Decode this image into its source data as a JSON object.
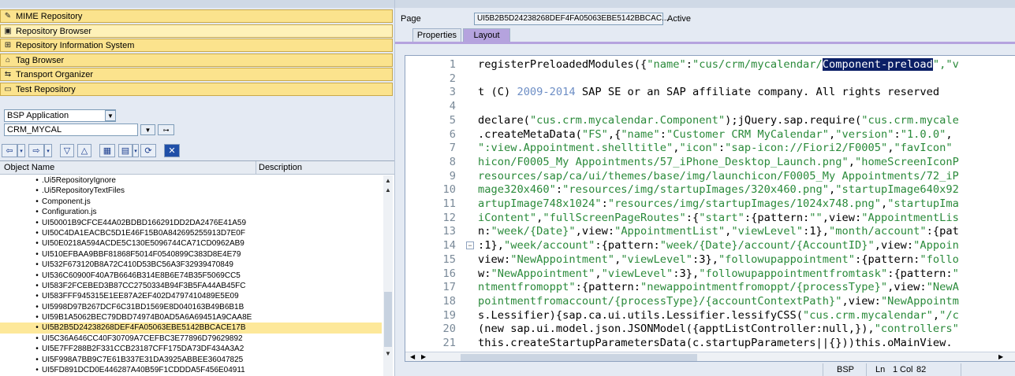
{
  "left_nav": {
    "items": [
      {
        "label": "MIME Repository",
        "icon": "mime-icon"
      },
      {
        "label": "Repository Browser",
        "icon": "browser-icon"
      },
      {
        "label": "Repository Information System",
        "icon": "info-system-icon"
      },
      {
        "label": "Tag Browser",
        "icon": "tag-icon"
      },
      {
        "label": "Transport Organizer",
        "icon": "transport-icon"
      },
      {
        "label": "Test Repository",
        "icon": "test-icon"
      }
    ]
  },
  "object_selector": {
    "type_value": "BSP Application",
    "name_value": "CRM_MYCAL"
  },
  "tree": {
    "col_object_name": "Object Name",
    "col_description": "Description",
    "rows": [
      ".Ui5RepositoryIgnore",
      ".Ui5RepositoryTextFiles",
      "Component.js",
      "Configuration.js",
      "UI50001B9CFCE44A02BDBD166291DD2DA2476E41A59",
      "UI50C4DA1EACBC5D1E46F15B0A842695255913D7E0F",
      "UI50E0218A594ACDE5C130E5096744CA71CD0962AB9",
      "UI510EFBAA9BBF81868F5014F0540899C383D8E4E79",
      "UI532F673120B8A72C410D53BC56A3F32939470849",
      "UI536C60900F40A7B6646B314E8B6E74B35F5069CC5",
      "UI583F2FCEBED3B87CC2750334B94F3B5FA44AB45FC",
      "UI583FFF945315E1EE87A2EF402D4797410489E5E09",
      "UI5998D97B267DCF6C31BD1569E8D040163B49B6B1B",
      "UI59B1A5062BEC79DBD74974B0AD5A6A69451A9CAA8E",
      "UI5B2B5D24238268DEF4FA05063EBE5142BBCACE17B",
      "UI5C36A646CC40F30709A7CEFBC3E77896D79629892",
      "UI5E7FF288B2F331CCB23187CFF175DA73DF434A3A2",
      "UI5F998A7BB9C7E61B337E31DA3925ABBEE36047825",
      "UI5FD891DCD0E446287A40B59F1CDDDA5F456E04911"
    ]
  },
  "right": {
    "page_label": "Page",
    "page_value": "UI5B2B5D24238268DEF4FA05063EBE5142BBCAC...",
    "page_status": "Active",
    "tab_properties": "Properties",
    "tab_layout": "Layout"
  },
  "code": {
    "lines": [
      {
        "n": "1",
        "segs": [
          [
            "registerPreloadedModules({",
            ""
          ],
          [
            "\"name\"",
            "g"
          ],
          [
            ":",
            ""
          ],
          [
            "\"cus/crm/mycalendar/",
            "g"
          ],
          [
            "Component-preload",
            "hl"
          ],
          [
            "\",\"v",
            "g"
          ]
        ]
      },
      {
        "n": "2",
        "segs": []
      },
      {
        "n": "3",
        "segs": [
          [
            "t (C) ",
            ""
          ],
          [
            "2009-2014",
            "b"
          ],
          [
            " SAP SE or an SAP affiliate company. All rights reserved",
            ""
          ]
        ]
      },
      {
        "n": "4",
        "segs": []
      },
      {
        "n": "5",
        "segs": [
          [
            "declare(",
            ""
          ],
          [
            "\"cus.crm.mycalendar.Component\"",
            "g"
          ],
          [
            ");jQuery.sap.require(",
            ""
          ],
          [
            "\"cus.crm.mycale",
            "g"
          ]
        ]
      },
      {
        "n": "6",
        "segs": [
          [
            ".createMetaData(",
            ""
          ],
          [
            "\"FS\"",
            "g"
          ],
          [
            ",{",
            ""
          ],
          [
            "\"name\"",
            "g"
          ],
          [
            ":",
            ""
          ],
          [
            "\"Customer CRM MyCalendar\"",
            "g"
          ],
          [
            ",",
            ""
          ],
          [
            "\"version\"",
            "g"
          ],
          [
            ":",
            ""
          ],
          [
            "\"1.0.0\"",
            "g"
          ],
          [
            ",",
            ""
          ]
        ]
      },
      {
        "n": "7",
        "segs": [
          [
            "\":view.Appointment.shelltitle\"",
            "g"
          ],
          [
            ",",
            ""
          ],
          [
            "\"icon\"",
            "g"
          ],
          [
            ":",
            ""
          ],
          [
            "\"sap-icon://Fiori2/F0005\"",
            "g"
          ],
          [
            ",",
            ""
          ],
          [
            "\"favIcon\"",
            "g"
          ]
        ]
      },
      {
        "n": "8",
        "segs": [
          [
            "hicon/F0005_My Appointments/57_iPhone_Desktop_Launch.png\"",
            "g"
          ],
          [
            ",",
            ""
          ],
          [
            "\"homeScreenIconP",
            "g"
          ]
        ]
      },
      {
        "n": "9",
        "segs": [
          [
            "resources/sap/ca/ui/themes/base/img/launchicon/F0005_My Appointments/72_iP",
            "g"
          ]
        ]
      },
      {
        "n": "10",
        "segs": [
          [
            "mage320x460\"",
            "g"
          ],
          [
            ":",
            ""
          ],
          [
            "\"resources/img/startupImages/320x460.png\"",
            "g"
          ],
          [
            ",",
            ""
          ],
          [
            "\"startupImage640x92",
            "g"
          ]
        ]
      },
      {
        "n": "11",
        "segs": [
          [
            "artupImage748x1024\"",
            "g"
          ],
          [
            ":",
            ""
          ],
          [
            "\"resources/img/startupImages/1024x748.png\"",
            "g"
          ],
          [
            ",",
            ""
          ],
          [
            "\"startupIma",
            "g"
          ]
        ]
      },
      {
        "n": "12",
        "segs": [
          [
            "iContent\"",
            "g"
          ],
          [
            ",",
            ""
          ],
          [
            "\"fullScreenPageRoutes\"",
            "g"
          ],
          [
            ":{",
            ""
          ],
          [
            "\"start\"",
            "g"
          ],
          [
            ":{pattern:",
            ""
          ],
          [
            "\"\"",
            "g"
          ],
          [
            ",view:",
            ""
          ],
          [
            "\"AppointmentLis",
            "g"
          ]
        ]
      },
      {
        "n": "13",
        "segs": [
          [
            "n:",
            ""
          ],
          [
            "\"week/{Date}\"",
            "g"
          ],
          [
            ",view:",
            ""
          ],
          [
            "\"AppointmentList\"",
            "g"
          ],
          [
            ",",
            ""
          ],
          [
            "\"viewLevel\"",
            "g"
          ],
          [
            ":1},",
            ""
          ],
          [
            "\"month/account\"",
            "g"
          ],
          [
            ":{pat",
            ""
          ]
        ]
      },
      {
        "n": "14",
        "segs": [
          [
            ":1},",
            ""
          ],
          [
            "\"week/account\"",
            "g"
          ],
          [
            ":{pattern:",
            ""
          ],
          [
            "\"week/{Date}/account/{AccountID}\"",
            "g"
          ],
          [
            ",view:",
            ""
          ],
          [
            "\"Appoin",
            "g"
          ]
        ]
      },
      {
        "n": "15",
        "segs": [
          [
            "view:",
            ""
          ],
          [
            "\"NewAppointment\"",
            "g"
          ],
          [
            ",",
            ""
          ],
          [
            "\"viewLevel\"",
            "g"
          ],
          [
            ":3},",
            ""
          ],
          [
            "\"followupappointment\"",
            "g"
          ],
          [
            ":{pattern:",
            ""
          ],
          [
            "\"follo",
            "g"
          ]
        ]
      },
      {
        "n": "16",
        "segs": [
          [
            "w:",
            ""
          ],
          [
            "\"NewAppointment\"",
            "g"
          ],
          [
            ",",
            ""
          ],
          [
            "\"viewLevel\"",
            "g"
          ],
          [
            ":3},",
            ""
          ],
          [
            "\"followupappointmentfromtask\"",
            "g"
          ],
          [
            ":{pattern:",
            ""
          ],
          [
            "\"",
            "g"
          ]
        ]
      },
      {
        "n": "17",
        "segs": [
          [
            "ntmentfromoppt\"",
            "g"
          ],
          [
            ":{pattern:",
            ""
          ],
          [
            "\"newappointmentfromoppt/{processType}\"",
            "g"
          ],
          [
            ",view:",
            ""
          ],
          [
            "\"NewA",
            "g"
          ]
        ]
      },
      {
        "n": "18",
        "segs": [
          [
            "pointmentfromaccount/{processType}/{accountContextPath}\"",
            "g"
          ],
          [
            ",view:",
            ""
          ],
          [
            "\"NewAppointm",
            "g"
          ]
        ]
      },
      {
        "n": "19",
        "segs": [
          [
            "s.Lessifier){sap.ca.ui.utils.Lessifier.lessifyCSS(",
            ""
          ],
          [
            "\"cus.crm.mycalendar\"",
            "g"
          ],
          [
            ",",
            ""
          ],
          [
            "\"/c",
            "g"
          ]
        ]
      },
      {
        "n": "20",
        "segs": [
          [
            "(new sap.ui.model.json.JSONModel({apptListController:null,}),",
            ""
          ],
          [
            "\"controllers\"",
            "g"
          ]
        ]
      },
      {
        "n": "21",
        "segs": [
          [
            "this.createStartupParametersData(c.startupParameters||{}))this.oMainView.",
            ""
          ]
        ]
      }
    ]
  },
  "status": {
    "type": "BSP",
    "ln_label": "Ln",
    "ln_value": "1",
    "col_label": "Col",
    "col_value": "82"
  }
}
